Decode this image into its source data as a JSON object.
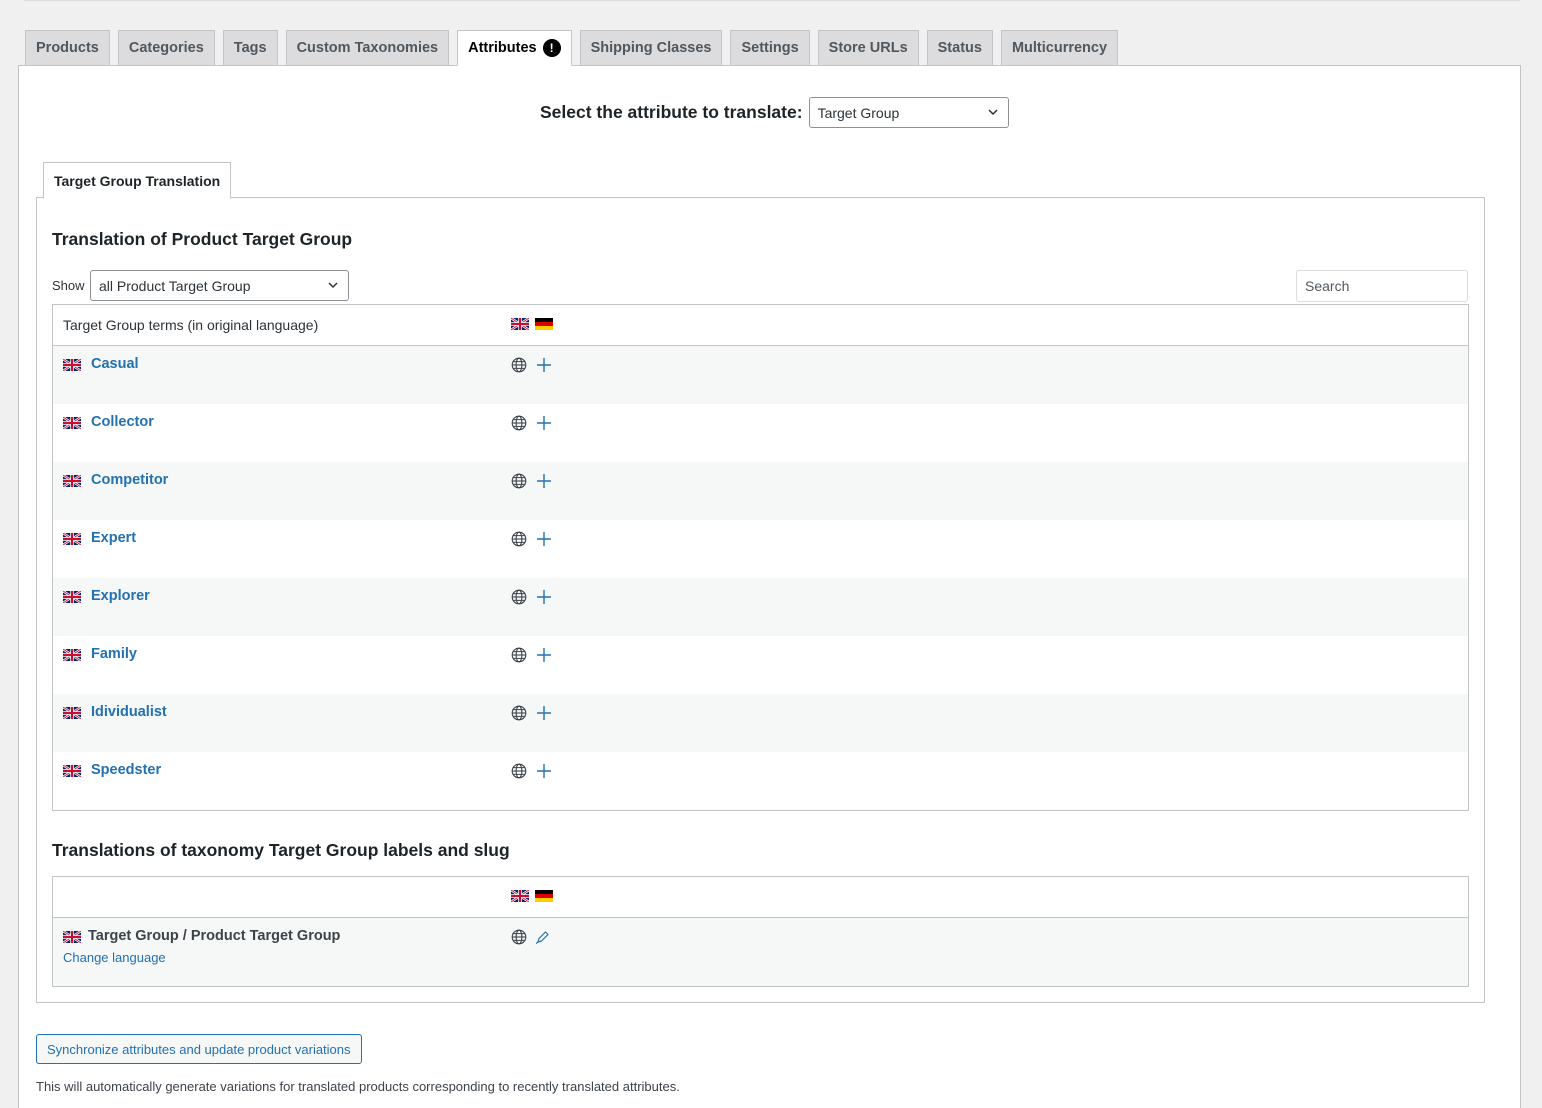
{
  "tabs": [
    {
      "label": "Products"
    },
    {
      "label": "Categories"
    },
    {
      "label": "Tags"
    },
    {
      "label": "Custom Taxonomies"
    },
    {
      "label": "Attributes",
      "active": true,
      "badge": "!"
    },
    {
      "label": "Shipping Classes"
    },
    {
      "label": "Settings"
    },
    {
      "label": "Store URLs"
    },
    {
      "label": "Status"
    },
    {
      "label": "Multicurrency"
    }
  ],
  "attribute_selector": {
    "label": "Select the attribute to translate:",
    "value": "Target Group"
  },
  "subtab": {
    "label": "Target Group Translation"
  },
  "terms_section": {
    "title": "Translation of Product Target Group",
    "show_label": "Show",
    "show_value": "all Product Target Group",
    "search_placeholder": "Search",
    "header": "Target Group terms (in original language)",
    "language_flags": [
      "uk-flag-icon",
      "de-flag-icon"
    ],
    "terms": [
      "Casual",
      "Collector",
      "Competitor",
      "Expert",
      "Explorer",
      "Family",
      "Idividualist",
      "Speedster"
    ]
  },
  "labels_section": {
    "title": "Translations of taxonomy Target Group labels and slug",
    "row_label": "Target Group / Product Target Group",
    "change_language": "Change language"
  },
  "sync_button": "Synchronize attributes and update product variations",
  "note": "This will automatically generate variations for translated products corresponding to recently translated attributes.",
  "colors": {
    "link": "#2271b1",
    "row_alt": "#f6f7f7",
    "border": "#c3c4c7"
  }
}
